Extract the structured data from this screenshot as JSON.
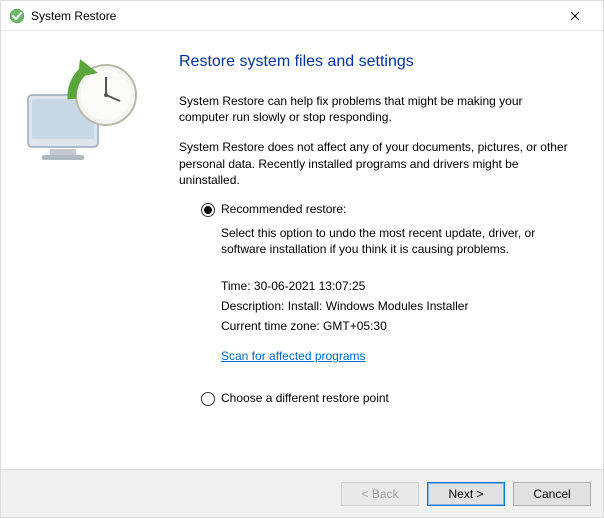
{
  "window": {
    "title": "System Restore"
  },
  "main": {
    "heading": "Restore system files and settings",
    "para1": "System Restore can help fix problems that might be making your computer run slowly or stop responding.",
    "para2": "System Restore does not affect any of your documents, pictures, or other personal data. Recently installed programs and drivers might be uninstalled."
  },
  "options": {
    "recommended": {
      "label": "Recommended restore:",
      "desc": "Select this option to undo the most recent update, driver, or software installation if you think it is causing problems.",
      "time_label": "Time: ",
      "time_value": "30-06-2021 13:07:25",
      "description_label": "Description: ",
      "description_value": "Install: Windows Modules Installer",
      "tz_label": "Current time zone: ",
      "tz_value": "GMT+05:30",
      "scan_link": "Scan for affected programs"
    },
    "alternate": {
      "label": "Choose a different restore point"
    }
  },
  "footer": {
    "back": "< Back",
    "next": "Next >",
    "cancel": "Cancel"
  }
}
